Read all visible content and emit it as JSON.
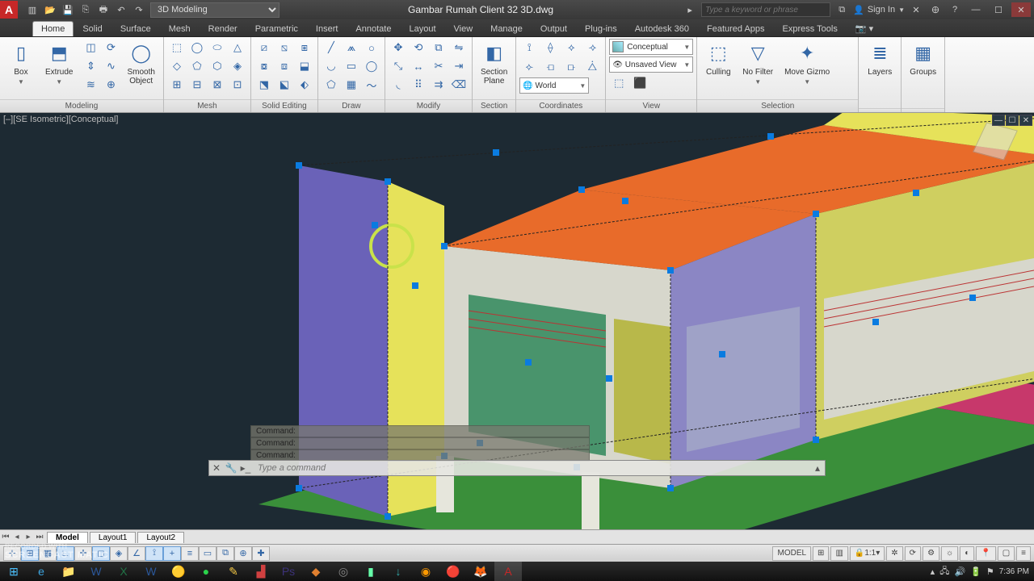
{
  "title": "Gambar Rumah Client 32 3D.dwg",
  "workspace": "3D Modeling",
  "search_placeholder": "Type a keyword or phrase",
  "signin": "Sign In",
  "tabs": [
    "Home",
    "Solid",
    "Surface",
    "Mesh",
    "Render",
    "Parametric",
    "Insert",
    "Annotate",
    "Layout",
    "View",
    "Manage",
    "Output",
    "Plug-ins",
    "Autodesk 360",
    "Featured Apps",
    "Express Tools"
  ],
  "active_tab": "Home",
  "panels": {
    "modeling": {
      "label": "Modeling",
      "box": "Box",
      "extrude": "Extrude",
      "smooth": "Smooth\nObject"
    },
    "mesh": {
      "label": "Mesh"
    },
    "solidedit": {
      "label": "Solid Editing"
    },
    "draw": {
      "label": "Draw"
    },
    "modify": {
      "label": "Modify"
    },
    "section": {
      "label": "Section",
      "plane": "Section\nPlane"
    },
    "coords": {
      "label": "Coordinates",
      "world": "World"
    },
    "view": {
      "label": "View",
      "conceptual": "Conceptual",
      "unsaved": "Unsaved View"
    },
    "selection": {
      "label": "Selection",
      "culling": "Culling",
      "nofilter": "No Filter",
      "movegizmo": "Move Gizmo"
    },
    "layers": {
      "label": "Layers"
    },
    "groups": {
      "label": "Groups"
    }
  },
  "viewport_label": "[–][SE Isometric][Conceptual]",
  "cmd_history": [
    "Command:",
    "Command:",
    "Command:"
  ],
  "cmd_placeholder": "Type a command",
  "layout_tabs": [
    "Model",
    "Layout1",
    "Layout2"
  ],
  "active_layout": "Model",
  "status": {
    "model": "MODEL",
    "scale": "1:1"
  },
  "clock": "7:36 PM",
  "watermark_top": "RECORDED WITH",
  "watermark_bottom": "SCREENCAST    MATIC",
  "colors": {
    "accent": "#c62828",
    "panel": "#e6e6e6",
    "vp": "#1d2a33"
  }
}
